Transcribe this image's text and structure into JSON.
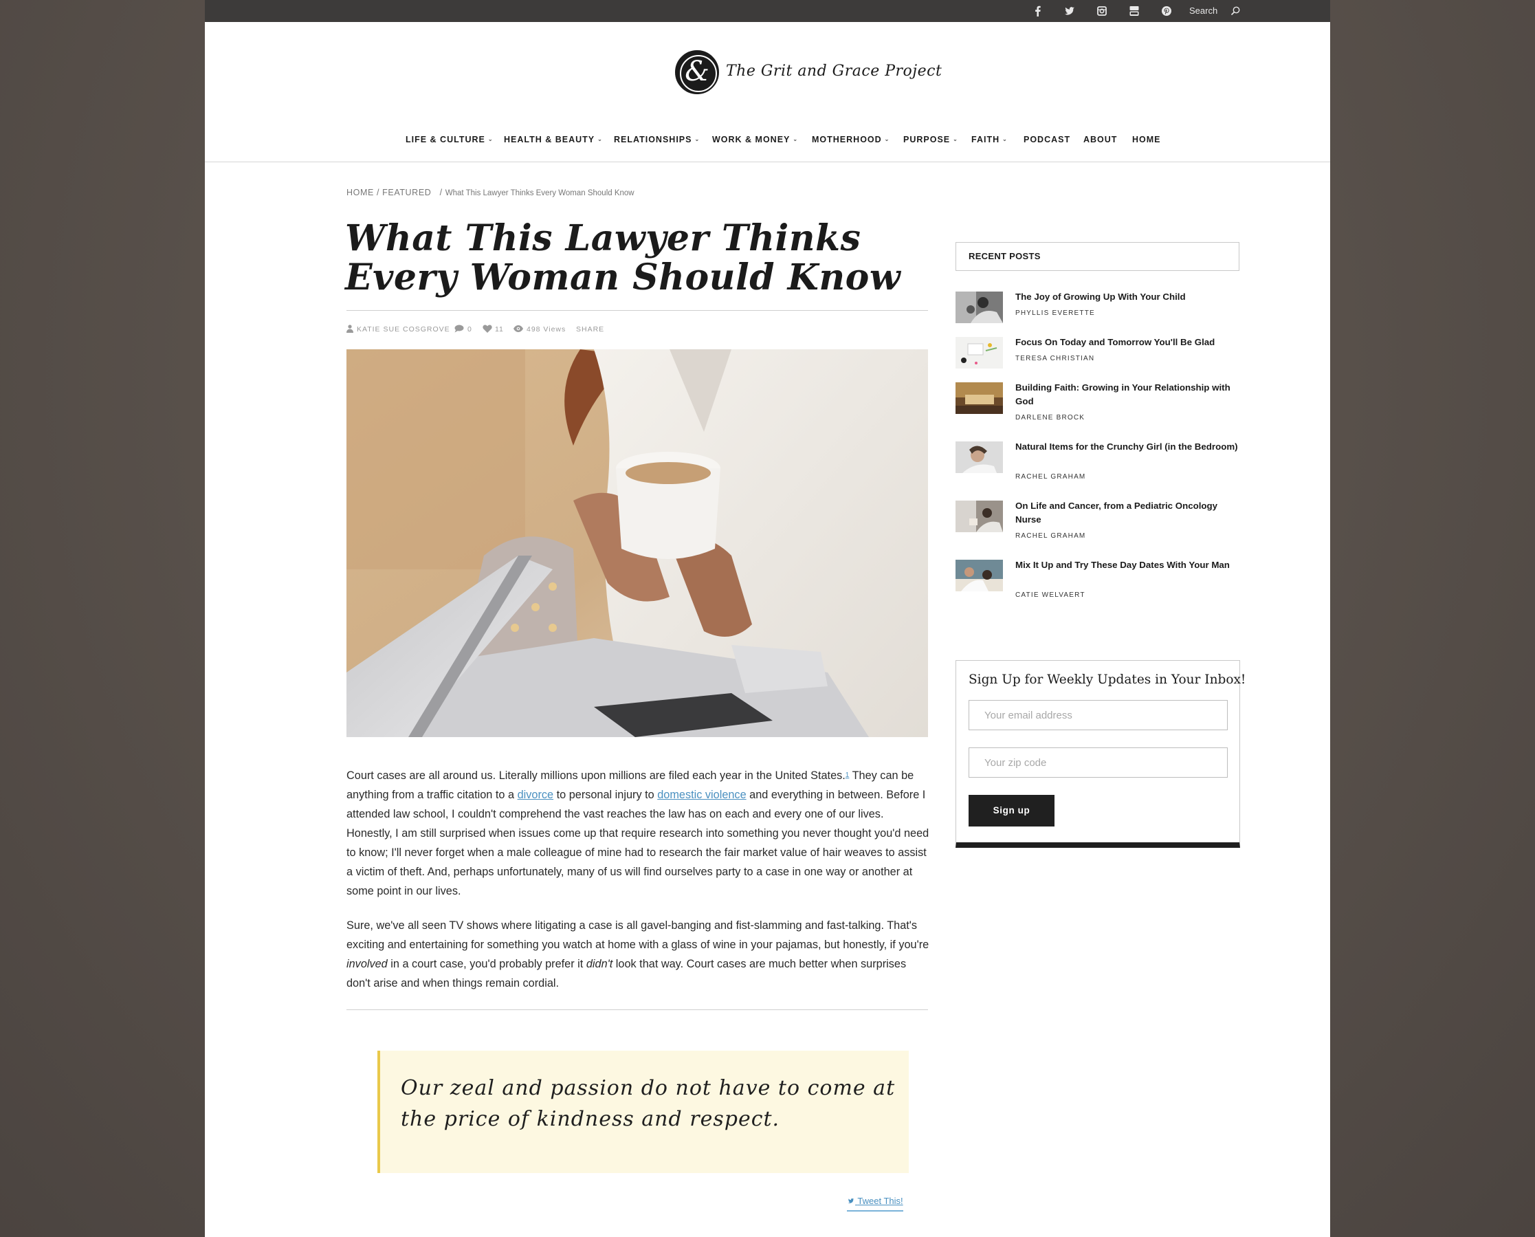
{
  "topbar": {
    "search_label": "Search"
  },
  "brand": {
    "name": "The Grit and Grace Project",
    "monogram": "&"
  },
  "nav": {
    "items": [
      {
        "label": "LIFE & CULTURE",
        "has_menu": true
      },
      {
        "label": "HEALTH & BEAUTY",
        "has_menu": true
      },
      {
        "label": "RELATIONSHIPS",
        "has_menu": true
      },
      {
        "label": "WORK & MONEY",
        "has_menu": true
      },
      {
        "label": "MOTHERHOOD",
        "has_menu": true
      },
      {
        "label": "PURPOSE",
        "has_menu": true
      },
      {
        "label": "FAITH",
        "has_menu": true
      },
      {
        "label": "PODCAST",
        "has_menu": false
      },
      {
        "label": "ABOUT",
        "has_menu": false
      },
      {
        "label": "HOME",
        "has_menu": false
      }
    ]
  },
  "breadcrumb": {
    "home": "HOME",
    "featured": "FEATURED",
    "current": "What This Lawyer Thinks Every Woman Should Know"
  },
  "article": {
    "title": "What This Lawyer Thinks Every Woman Should Know",
    "author": "KATIE SUE COSGROVE",
    "comments": "0",
    "likes": "11",
    "views": "498 Views",
    "share": "SHARE",
    "p1_a": "Court cases are all around us. Literally millions upon millions are filed each year in the United States.",
    "p1_sup": "1",
    "p1_b": " They can be anything from a traffic citation to a ",
    "p1_link1": "divorce",
    "p1_c": " to personal injury to ",
    "p1_link2": "domestic violence",
    "p1_d": " and everything in between. Before I attended law school, I couldn't comprehend the vast reaches the law has on each and every one of our lives. Honestly, I am still surprised when issues come up that require research into something you never thought you'd need to know; I'll never forget when a male colleague of mine had to research the fair market value of hair weaves to assist a victim of theft. And, perhaps unfortunately, many of us will find ourselves party to a case in one way or another at some point in our lives.",
    "p2_a": "Sure, we've all seen TV shows where litigating a case is all gavel-banging and fist-slamming and fast-talking. That's exciting and entertaining for something you watch at home with a glass of wine in your pajamas, but honestly, if you're ",
    "p2_em1": "involved",
    "p2_b": " in a court case, you'd probably prefer it ",
    "p2_em2": "didn't",
    "p2_c": " look that way. Court cases are much better when surprises don't arise and when things remain cordial.",
    "quote": "Our zeal and passion do not have to come at the price of kindness and respect.",
    "tweet": "Tweet This!"
  },
  "sidebar": {
    "recent_heading": "RECENT POSTS",
    "posts": [
      {
        "title": "The Joy of Growing Up With Your Child",
        "author": "PHYLLIS EVERETTE"
      },
      {
        "title": "Focus On Today and Tomorrow You'll Be Glad",
        "author": "TERESA CHRISTIAN"
      },
      {
        "title": "Building Faith: Growing in Your Relationship with God",
        "author": "DARLENE BROCK"
      },
      {
        "title": "Natural Items for the Crunchy Girl (in the Bedroom)",
        "author": "RACHEL GRAHAM"
      },
      {
        "title": "On Life and Cancer, from a Pediatric Oncology Nurse",
        "author": "RACHEL GRAHAM"
      },
      {
        "title": "Mix It Up and Try These Day Dates With Your Man",
        "author": "CATIE WELVAERT"
      }
    ],
    "signup": {
      "heading": "Sign Up for Weekly Updates in Your Inbox!",
      "email_placeholder": "Your email address",
      "zip_placeholder": "Your zip code",
      "button": "Sign up"
    }
  }
}
